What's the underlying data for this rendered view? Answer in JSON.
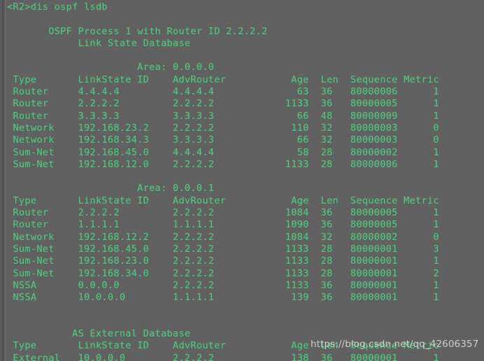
{
  "terminal": {
    "background_color": "#616161",
    "text_color": "#4ecb80",
    "prompt_line": "<R2>dis ospf lsdb",
    "process_header": "OSPF Process 1 with Router ID 2.2.2.2",
    "database_title": "Link State Database",
    "columns": [
      "Type",
      "LinkState ID",
      "AdvRouter",
      "Age",
      "Len",
      "Sequence",
      "Metric"
    ],
    "sections": [
      {
        "heading": "Area: 0.0.0.0",
        "rows": [
          {
            "type": "Router",
            "linkstate_id": "4.4.4.4",
            "advrouter": "4.4.4.4",
            "age": "63",
            "len": "36",
            "sequence": "80000006",
            "metric": "1"
          },
          {
            "type": "Router",
            "linkstate_id": "2.2.2.2",
            "advrouter": "2.2.2.2",
            "age": "1133",
            "len": "36",
            "sequence": "80000005",
            "metric": "1"
          },
          {
            "type": "Router",
            "linkstate_id": "3.3.3.3",
            "advrouter": "3.3.3.3",
            "age": "66",
            "len": "48",
            "sequence": "80000009",
            "metric": "1"
          },
          {
            "type": "Network",
            "linkstate_id": "192.168.23.2",
            "advrouter": "2.2.2.2",
            "age": "110",
            "len": "32",
            "sequence": "80000003",
            "metric": "0"
          },
          {
            "type": "Network",
            "linkstate_id": "192.168.34.3",
            "advrouter": "3.3.3.3",
            "age": "66",
            "len": "32",
            "sequence": "80000003",
            "metric": "0"
          },
          {
            "type": "Sum-Net",
            "linkstate_id": "192.168.45.0",
            "advrouter": "4.4.4.4",
            "age": "58",
            "len": "28",
            "sequence": "80000002",
            "metric": "1"
          },
          {
            "type": "Sum-Net",
            "linkstate_id": "192.168.12.0",
            "advrouter": "2.2.2.2",
            "age": "1133",
            "len": "28",
            "sequence": "80000006",
            "metric": "1"
          }
        ]
      },
      {
        "heading": "Area: 0.0.0.1",
        "rows": [
          {
            "type": "Router",
            "linkstate_id": "2.2.2.2",
            "advrouter": "2.2.2.2",
            "age": "1084",
            "len": "36",
            "sequence": "80000005",
            "metric": "1"
          },
          {
            "type": "Router",
            "linkstate_id": "1.1.1.1",
            "advrouter": "1.1.1.1",
            "age": "1090",
            "len": "36",
            "sequence": "80000005",
            "metric": "1"
          },
          {
            "type": "Network",
            "linkstate_id": "192.168.12.2",
            "advrouter": "2.2.2.2",
            "age": "1084",
            "len": "32",
            "sequence": "80000002",
            "metric": "0"
          },
          {
            "type": "Sum-Net",
            "linkstate_id": "192.168.45.0",
            "advrouter": "2.2.2.2",
            "age": "1133",
            "len": "28",
            "sequence": "80000001",
            "metric": "3"
          },
          {
            "type": "Sum-Net",
            "linkstate_id": "192.168.23.0",
            "advrouter": "2.2.2.2",
            "age": "1133",
            "len": "28",
            "sequence": "80000001",
            "metric": "1"
          },
          {
            "type": "Sum-Net",
            "linkstate_id": "192.168.34.0",
            "advrouter": "2.2.2.2",
            "age": "1133",
            "len": "28",
            "sequence": "80000001",
            "metric": "2"
          },
          {
            "type": "NSSA",
            "linkstate_id": "0.0.0.0",
            "advrouter": "2.2.2.2",
            "age": "1133",
            "len": "36",
            "sequence": "80000001",
            "metric": "1"
          },
          {
            "type": "NSSA",
            "linkstate_id": "10.0.0.0",
            "advrouter": "1.1.1.1",
            "age": "139",
            "len": "36",
            "sequence": "80000001",
            "metric": "1"
          }
        ]
      },
      {
        "heading": "AS External Database",
        "rows": [
          {
            "type": "External",
            "linkstate_id": "10.0.0.0",
            "advrouter": "2.2.2.2",
            "age": "138",
            "len": "36",
            "sequence": "80000001",
            "metric": "1"
          }
        ]
      }
    ]
  },
  "watermark": {
    "text": "https://blog.csdn.net/qq_42606357"
  }
}
